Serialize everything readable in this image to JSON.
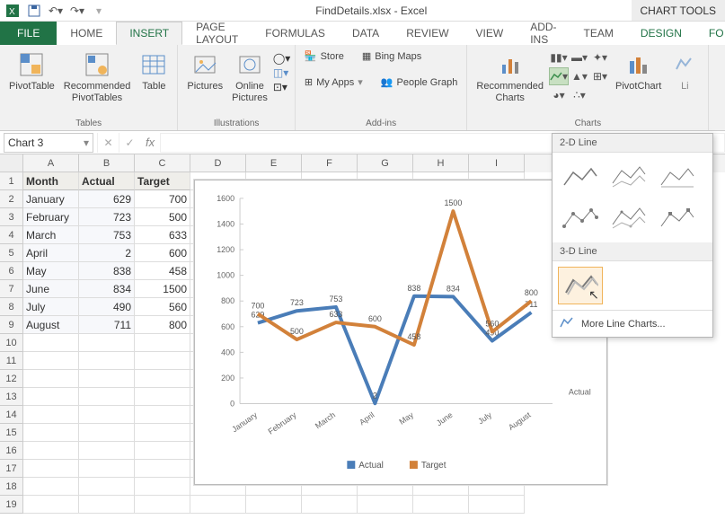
{
  "app": {
    "title": "FindDetails.xlsx - Excel",
    "context_tab_group": "CHART TOOLS"
  },
  "qat": {
    "save_tip": "Save",
    "undo_tip": "Undo",
    "redo_tip": "Redo"
  },
  "tabs": {
    "file": "FILE",
    "home": "HOME",
    "insert": "INSERT",
    "page_layout": "PAGE LAYOUT",
    "formulas": "FORMULAS",
    "data": "DATA",
    "review": "REVIEW",
    "view": "VIEW",
    "addins": "ADD-INS",
    "team": "TEAM",
    "design": "DESIGN",
    "format_partial": "FO"
  },
  "ribbon": {
    "tables": {
      "pivottable": "PivotTable",
      "recommended_pivottables": "Recommended\nPivotTables",
      "table": "Table",
      "group": "Tables"
    },
    "illustrations": {
      "pictures": "Pictures",
      "online_pictures": "Online\nPictures",
      "group": "Illustrations"
    },
    "addins": {
      "store": "Store",
      "my_apps": "My Apps",
      "bing_maps": "Bing Maps",
      "people_graph": "People Graph",
      "group": "Add-ins"
    },
    "charts": {
      "recommended_charts": "Recommended\nCharts",
      "pivotchart": "PivotChart",
      "group": "Charts",
      "li_partial": "Li"
    }
  },
  "line_dropdown": {
    "section_2d": "2-D Line",
    "section_3d": "3-D Line",
    "more": "More Line Charts..."
  },
  "formula_bar": {
    "name_box": "Chart 3",
    "formula": ""
  },
  "columns": [
    "A",
    "B",
    "C",
    "D",
    "E",
    "F",
    "G",
    "H",
    "I"
  ],
  "rows": [
    "1",
    "2",
    "3",
    "4",
    "5",
    "6",
    "7",
    "8",
    "9",
    "10",
    "11",
    "12",
    "13",
    "14",
    "15",
    "16",
    "17",
    "18",
    "19"
  ],
  "table": {
    "headers": {
      "month": "Month",
      "actual": "Actual",
      "target": "Target"
    },
    "rows": [
      {
        "month": "January",
        "actual": 629,
        "target": 700
      },
      {
        "month": "February",
        "actual": 723,
        "target": 500
      },
      {
        "month": "March",
        "actual": 753,
        "target": 633
      },
      {
        "month": "April",
        "actual": 2,
        "target": 600
      },
      {
        "month": "May",
        "actual": 838,
        "target": 458
      },
      {
        "month": "June",
        "actual": 834,
        "target": 1500
      },
      {
        "month": "July",
        "actual": 490,
        "target": 560
      },
      {
        "month": "August",
        "actual": 711,
        "target": 800
      }
    ]
  },
  "chart_data": {
    "type": "line",
    "title": "",
    "xlabel": "",
    "ylabel": "",
    "ylim": [
      0,
      1600
    ],
    "yticks": [
      0,
      200,
      400,
      600,
      800,
      1000,
      1200,
      1400,
      1600
    ],
    "categories": [
      "January",
      "February",
      "March",
      "April",
      "May",
      "June",
      "July",
      "August"
    ],
    "series": [
      {
        "name": "Actual",
        "color": "#4a7db8",
        "values": [
          629,
          723,
          753,
          2,
          838,
          834,
          490,
          711
        ]
      },
      {
        "name": "Target",
        "color": "#d2813a",
        "values": [
          700,
          500,
          633,
          600,
          458,
          1500,
          560,
          800
        ]
      }
    ],
    "axis_depth_label": "Actual",
    "legend_position": "bottom",
    "is_3d": true
  }
}
